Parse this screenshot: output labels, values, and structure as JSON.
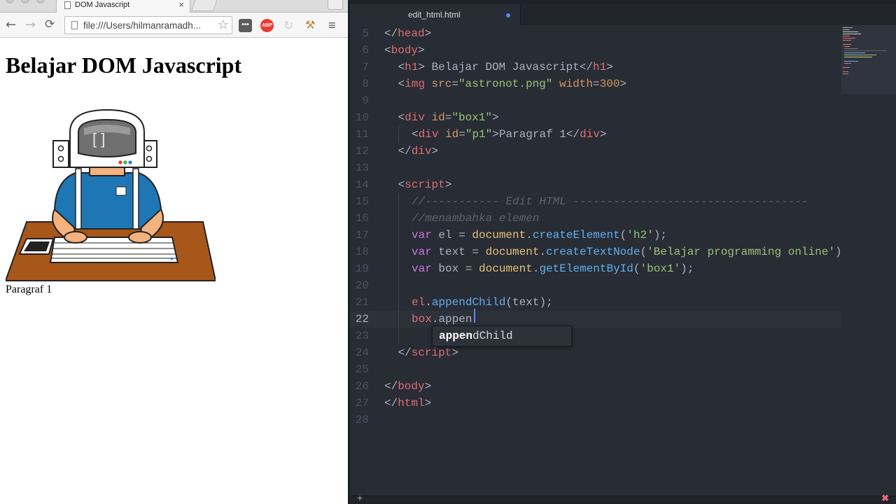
{
  "browser": {
    "tab_title": "DOM Javascript",
    "tab_close": "×",
    "url": "file:///Users/hilmanramadh...",
    "icons": [
      "back-arrow-icon",
      "forward-arrow-icon",
      "reload-icon",
      "bookmark-star-icon",
      "extension-dots-icon",
      "adblock-icon",
      "sync-icon",
      "tool-icon",
      "menu-icon"
    ],
    "ext_abp_label": "ABP",
    "page": {
      "heading": "Belajar DOM Javascript",
      "image_name": "astronot.png",
      "image_visor_text": "[ ]",
      "paragraph": "Paragraf 1"
    }
  },
  "editor": {
    "tab_title": "edit_html.html",
    "modified_dot_color": "#568af2",
    "current_line": 22,
    "lines": [
      {
        "n": "5"
      },
      {
        "n": "6"
      },
      {
        "n": "7"
      },
      {
        "n": "8"
      },
      {
        "n": "9"
      },
      {
        "n": "10"
      },
      {
        "n": "11"
      },
      {
        "n": "12"
      },
      {
        "n": "13"
      },
      {
        "n": "14"
      },
      {
        "n": "15"
      },
      {
        "n": "16"
      },
      {
        "n": "17"
      },
      {
        "n": "18"
      },
      {
        "n": "19"
      },
      {
        "n": "20"
      },
      {
        "n": "21"
      },
      {
        "n": "22"
      },
      {
        "n": "23"
      },
      {
        "n": "24"
      },
      {
        "n": "25"
      },
      {
        "n": "26"
      },
      {
        "n": "27"
      },
      {
        "n": "28"
      }
    ],
    "code": {
      "l5": [
        "</",
        "head",
        ">"
      ],
      "l6": [
        "<",
        "body",
        ">"
      ],
      "l7": [
        "<",
        "h1",
        ">",
        " Belajar DOM Javascript",
        "</",
        "h1",
        ">"
      ],
      "l8": [
        "<",
        "img",
        " ",
        "src",
        "=",
        "\"astronot.png\"",
        " ",
        "width",
        "=",
        "300",
        ">"
      ],
      "l10": [
        "<",
        "div",
        " ",
        "id",
        "=",
        "\"box1\"",
        ">"
      ],
      "l11": [
        "<",
        "div",
        " ",
        "id",
        "=",
        "\"p1\"",
        ">",
        "Paragraf 1",
        "</",
        "div",
        ">"
      ],
      "l12": [
        "</",
        "div",
        ">"
      ],
      "l14": [
        "<",
        "script",
        ">"
      ],
      "l15": "//----------- Edit HTML -----------------------------------",
      "l16": "//menambahka elemen",
      "l17": [
        "var",
        " el = ",
        "document",
        ".",
        "createElement",
        "(",
        "'h2'",
        ");"
      ],
      "l18": [
        "var",
        " text = ",
        "document",
        ".",
        "createTextNode",
        "(",
        "'Belajar programming online'",
        ")"
      ],
      "l19": [
        "var",
        " box = ",
        "document",
        ".",
        "getElementById",
        "(",
        "'box1'",
        ");"
      ],
      "l21": [
        "el",
        ".",
        "appendChild",
        "(text);"
      ],
      "l22": [
        "box",
        ".appen"
      ],
      "l24": [
        "</",
        "scri",
        "pt",
        ">"
      ],
      "l26": [
        "</",
        "body",
        ">"
      ],
      "l27": [
        "</",
        "html",
        ">"
      ]
    },
    "autocomplete": {
      "typed": "appen",
      "rest": "dChild"
    },
    "status": {
      "plus": "+",
      "error": "✖"
    },
    "colors": {
      "background": "#282c34",
      "tag": "#e06c75",
      "attribute": "#d19a66",
      "string": "#98c379",
      "keyword": "#c678dd",
      "object": "#e5c07b",
      "function": "#61afef",
      "comment": "#5c6370"
    }
  }
}
